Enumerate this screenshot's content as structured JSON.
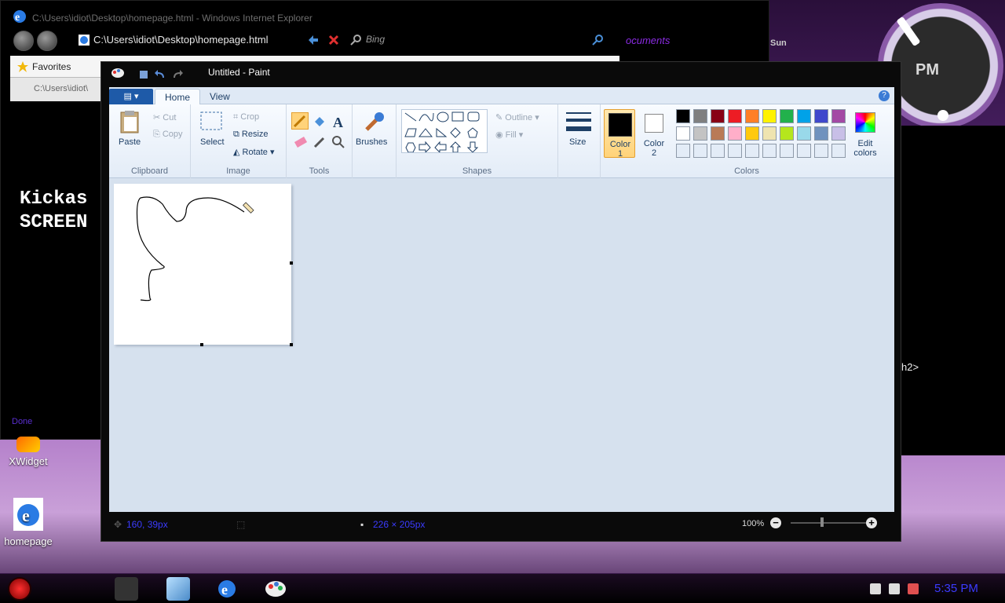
{
  "clock": {
    "label": "PM",
    "day": "Sun"
  },
  "ie": {
    "title": "C:\\Users\\idiot\\Desktop\\homepage.html - Windows Internet Explorer",
    "address": "C:\\Users\\idiot\\Desktop\\homepage.html",
    "search_placeholder": "Bing",
    "favorites_label": "Favorites",
    "tab_label": "C:\\Users\\idiot\\",
    "content_line1": "Kickas",
    "content_line2": "SCREEN",
    "status": "Done",
    "docs_link": "ocuments"
  },
  "right_window": {
    "text": "h2>"
  },
  "desktop_icons": [
    {
      "label": "XWidget"
    },
    {
      "label": "homepage"
    }
  ],
  "paint": {
    "title": "Untitled - Paint",
    "tabs": [
      {
        "label": "Home"
      },
      {
        "label": "View"
      }
    ],
    "clipboard": {
      "paste": "Paste",
      "cut": "Cut",
      "copy": "Copy",
      "group": "Clipboard"
    },
    "image": {
      "select": "Select",
      "crop": "Crop",
      "resize": "Resize",
      "rotate": "Rotate",
      "group": "Image"
    },
    "tools": {
      "group": "Tools"
    },
    "brushes": {
      "label": "Brushes"
    },
    "shapes": {
      "outline": "Outline",
      "fill": "Fill",
      "group": "Shapes"
    },
    "size": {
      "label": "Size"
    },
    "colors": {
      "color1": "Color\n1",
      "color1_a": "Color",
      "color1_b": "1",
      "color2_a": "Color",
      "color2_b": "2",
      "edit": "Edit",
      "edit_b": "colors",
      "group": "Colors",
      "row1": [
        "#000000",
        "#7f7f7f",
        "#880015",
        "#ed1c24",
        "#ff7f27",
        "#fff200",
        "#22b14c",
        "#00a2e8",
        "#3f48cc",
        "#a349a4"
      ],
      "row2": [
        "#ffffff",
        "#c3c3c3",
        "#b97a57",
        "#ffaec9",
        "#ffc90e",
        "#efe4b0",
        "#b5e61d",
        "#99d9ea",
        "#7092be",
        "#c8bfe7"
      ]
    },
    "status": {
      "cursor": "160, 39px",
      "size": "226 × 205px",
      "zoom": "100%"
    }
  },
  "taskbar": {
    "time": "5:35 PM"
  }
}
